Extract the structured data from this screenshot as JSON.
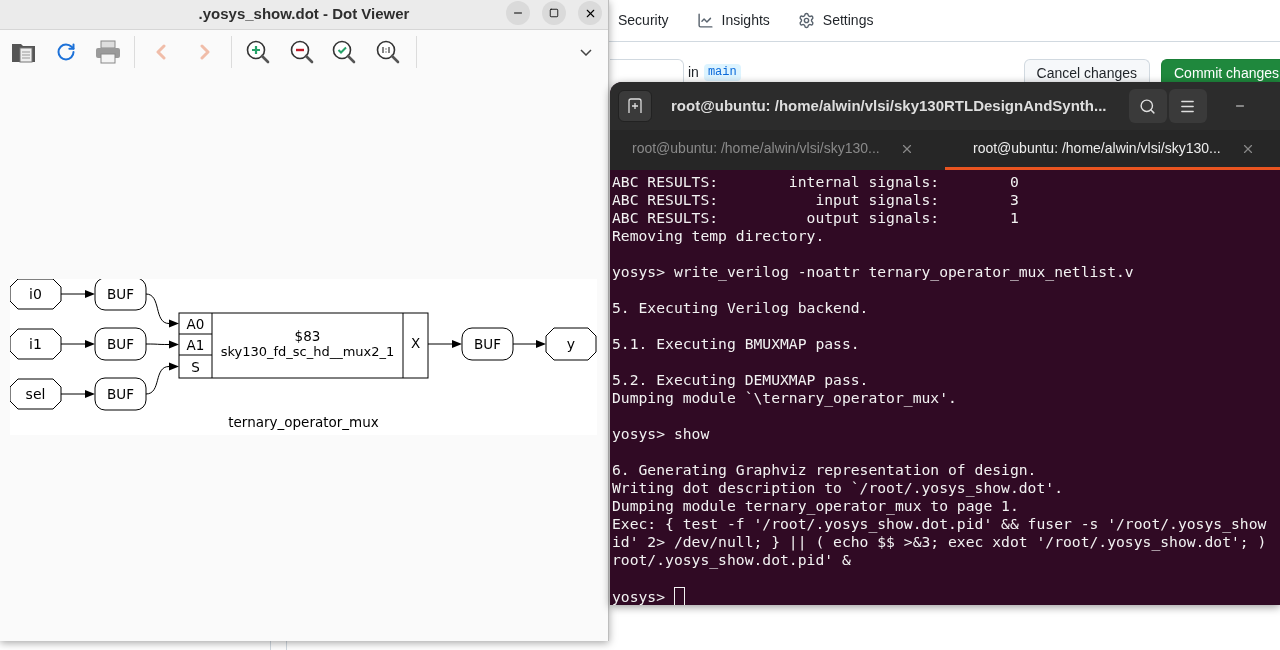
{
  "browser": {
    "nav": [
      {
        "label": "Security",
        "kind": "plain"
      },
      {
        "label": "Insights",
        "kind": "chart"
      },
      {
        "label": "Settings",
        "kind": "gear"
      }
    ],
    "branch_prefix": "in",
    "branch": "main",
    "buttons": [
      {
        "label": "Cancel changes",
        "kind": "secondary"
      },
      {
        "label": "Commit changes",
        "kind": "primary"
      }
    ]
  },
  "dot_viewer": {
    "title": ".yosys_show.dot - Dot Viewer",
    "back_disabled": true,
    "forward_disabled": true,
    "diagram": {
      "inputs": [
        {
          "label": "i0"
        },
        {
          "label": "i1"
        },
        {
          "label": "sel"
        }
      ],
      "input_buffers": [
        {
          "label": "BUF"
        },
        {
          "label": "BUF"
        },
        {
          "label": "BUF"
        }
      ],
      "cell": {
        "name": "$83",
        "type": "sky130_fd_sc_hd__mux2_1",
        "input_pins": [
          "A0",
          "A1",
          "S"
        ],
        "output_pin": "X"
      },
      "output_buffer": {
        "label": "BUF"
      },
      "output": {
        "label": "y"
      },
      "caption": "ternary_operator_mux"
    }
  },
  "terminal": {
    "title": "root@ubuntu: /home/alwin/vlsi/sky130RTLDesignAndSynth...",
    "tabs": [
      {
        "label": "root@ubuntu: /home/alwin/vlsi/sky130...",
        "selected": false
      },
      {
        "label": "root@ubuntu: /home/alwin/vlsi/sky130...",
        "selected": true
      }
    ],
    "blocks": [
      [
        "ABC RESULTS:        internal signals:        0",
        "ABC RESULTS:           input signals:        3",
        "ABC RESULTS:          output signals:        1",
        "Removing temp directory."
      ],
      [
        "yosys> write_verilog -noattr ternary_operator_mux_netlist.v"
      ],
      [
        "5. Executing Verilog backend."
      ],
      [
        "5.1. Executing BMUXMAP pass."
      ],
      [
        "5.2. Executing DEMUXMAP pass.",
        "Dumping module `\\ternary_operator_mux'."
      ],
      [
        "yosys> show"
      ],
      [
        "6. Generating Graphviz representation of design.",
        "Writing dot description to `/root/.yosys_show.dot'.",
        "Dumping module ternary_operator_mux to page 1.",
        "Exec: { test -f '/root/.yosys_show.dot.pid' && fuser -s '/root/.yosys_show",
        "id' 2> /dev/null; } || ( echo $$ >&3; exec xdot '/root/.yosys_show.dot'; )",
        "root/.yosys_show.dot.pid' &"
      ]
    ],
    "prompt": "yosys>",
    "cursor": true
  }
}
